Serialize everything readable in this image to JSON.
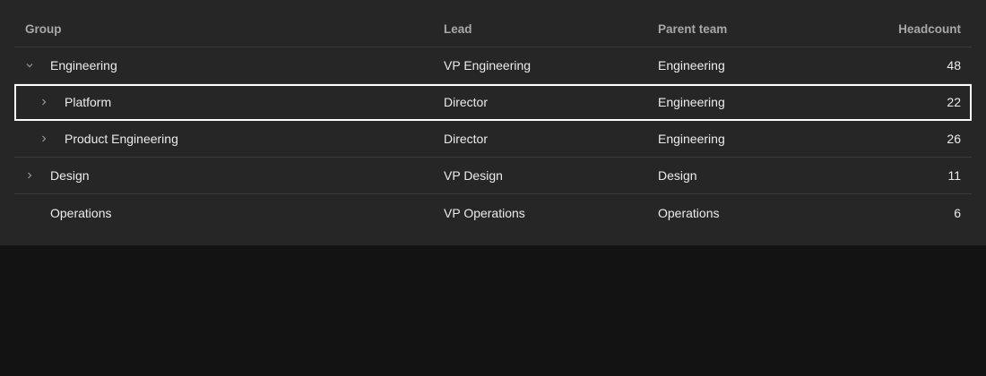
{
  "columns": {
    "group": "Group",
    "lead": "Lead",
    "parent_team": "Parent team",
    "headcount": "Headcount"
  },
  "rows": [
    {
      "group": "Engineering",
      "lead": "VP Engineering",
      "parent_team": "Engineering",
      "headcount": "48",
      "level": 0,
      "expander": "chevron-down-icon"
    },
    {
      "group": "Platform",
      "lead": "Director",
      "parent_team": "Engineering",
      "headcount": "22",
      "level": 1,
      "expander": "chevron-right-icon",
      "focused": true
    },
    {
      "group": "Product Engineering",
      "lead": "Director",
      "parent_team": "Engineering",
      "headcount": "26",
      "level": 1,
      "expander": "chevron-right-icon"
    },
    {
      "group": "Design",
      "lead": "VP Design",
      "parent_team": "Design",
      "headcount": "11",
      "level": 0,
      "expander": "chevron-right-icon"
    },
    {
      "group": "Operations",
      "lead": "VP Operations",
      "parent_team": "Operations",
      "headcount": "6",
      "level": 0,
      "expander": ""
    }
  ],
  "colors": {
    "panel_bg": "#262626",
    "page_bg": "#131313",
    "text": "#ececec",
    "header_text": "#a8a8a8",
    "row_divider": "#3a3a3a",
    "focus_outline": "#ffffff"
  }
}
